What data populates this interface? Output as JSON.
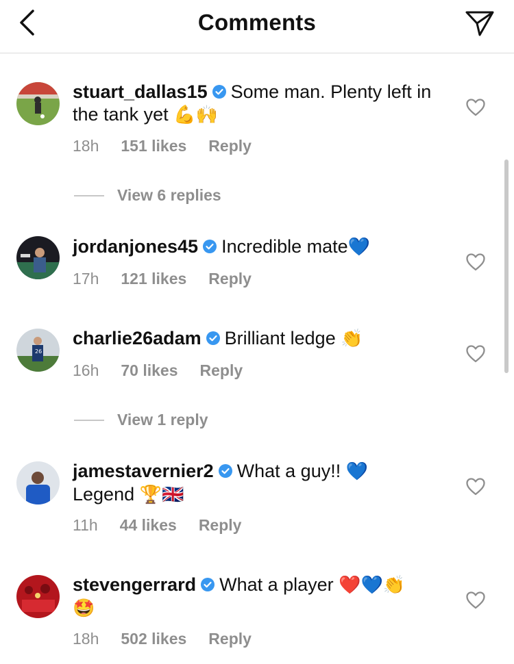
{
  "header": {
    "title": "Comments"
  },
  "comments": [
    {
      "username": "stuart_dallas15",
      "text": "Some man. Plenty left in the tank yet",
      "emoji": "💪🙌",
      "time": "18h",
      "likes": "151 likes",
      "reply": "Reply",
      "view_replies": "View 6 replies"
    },
    {
      "username": "jordanjones45",
      "text": "Incredible mate",
      "emoji": "💙",
      "time": "17h",
      "likes": "121 likes",
      "reply": "Reply"
    },
    {
      "username": "charlie26adam",
      "text": "Brilliant ledge",
      "emoji": "👏",
      "time": "16h",
      "likes": "70 likes",
      "reply": "Reply",
      "view_replies": "View 1 reply"
    },
    {
      "username": "jamestavernier2",
      "text": "What a guy!!",
      "emoji": "💙",
      "text2": "Legend",
      "emoji2": "🏆🇬🇧",
      "time": "11h",
      "likes": "44 likes",
      "reply": "Reply"
    },
    {
      "username": "stevengerrard",
      "text": "What a player",
      "emoji": "❤️💙👏",
      "emoji2": "🤩",
      "time": "18h",
      "likes": "502 likes",
      "reply": "Reply"
    }
  ],
  "colors": {
    "verified": "#3897f0",
    "meta": "#8e8e8e",
    "divider": "#dbdbdb"
  },
  "icons": {
    "back": "back-chevron-icon",
    "share": "paper-plane-icon",
    "like": "heart-outline-icon",
    "verified": "verified-badge-icon"
  }
}
